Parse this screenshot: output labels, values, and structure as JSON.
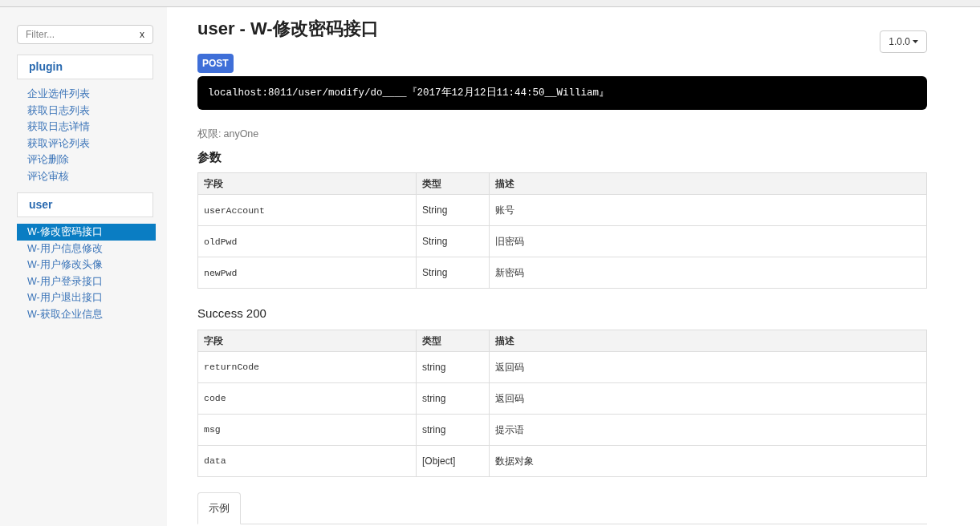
{
  "sidebar": {
    "filter": {
      "placeholder": "Filter...",
      "clear": "x"
    },
    "groups": [
      {
        "name": "plugin",
        "items": [
          {
            "label": "企业选件列表",
            "selected": false
          },
          {
            "label": "获取日志列表",
            "selected": false
          },
          {
            "label": "获取日志详情",
            "selected": false
          },
          {
            "label": "获取评论列表",
            "selected": false
          },
          {
            "label": "评论删除",
            "selected": false
          },
          {
            "label": "评论审核",
            "selected": false
          }
        ]
      },
      {
        "name": "user",
        "items": [
          {
            "label": "W-修改密码接口",
            "selected": true
          },
          {
            "label": "W-用户信息修改",
            "selected": false
          },
          {
            "label": "W-用户修改头像",
            "selected": false
          },
          {
            "label": "W-用户登录接口",
            "selected": false
          },
          {
            "label": "W-用户退出接口",
            "selected": false
          },
          {
            "label": "W-获取企业信息",
            "selected": false
          }
        ]
      }
    ]
  },
  "title": "user - W-修改密码接口",
  "version": "1.0.0",
  "method": "POST",
  "url": "localhost:8011/user/modify/do____『2017年12月12日11:44:50__William』",
  "permission": {
    "label": "权限:",
    "value": "anyOne"
  },
  "sections": [
    {
      "title": "参数",
      "columns": [
        "字段",
        "类型",
        "描述"
      ],
      "rows": [
        [
          "userAccount",
          "String",
          "账号"
        ],
        [
          "oldPwd",
          "String",
          "旧密码"
        ],
        [
          "newPwd",
          "String",
          "新密码"
        ]
      ]
    },
    {
      "title": "Success 200",
      "columns": [
        "字段",
        "类型",
        "描述"
      ],
      "rows": [
        [
          "returnCode",
          "string",
          "返回码"
        ],
        [
          "code",
          "string",
          "返回码"
        ],
        [
          "msg",
          "string",
          "提示语"
        ],
        [
          "data",
          "[Object]",
          "数据对象"
        ]
      ]
    }
  ],
  "tabs": [
    {
      "label": "示例",
      "selected": true
    }
  ]
}
